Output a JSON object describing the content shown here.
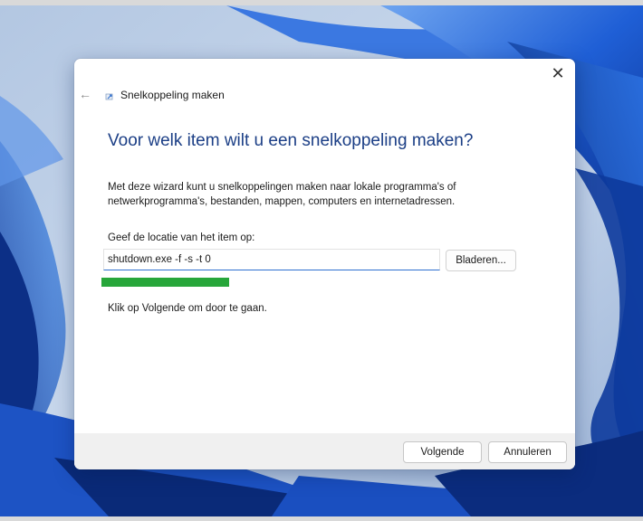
{
  "window": {
    "title": "Snelkoppeling maken",
    "close_glyph": "✕",
    "back_glyph": "←"
  },
  "wizard": {
    "heading": "Voor welk item wilt u een snelkoppeling maken?",
    "description": "Met deze wizard kunt u snelkoppelingen maken naar lokale programma's of netwerkprogramma's, bestanden, mappen, computers en internetadressen.",
    "field_label": "Geef de locatie van het item op:",
    "location_value": "shutdown.exe -f -s -t 0",
    "browse_label": "Bladeren...",
    "instruction": "Klik op Volgende om door te gaan."
  },
  "footer": {
    "next_label": "Volgende",
    "cancel_label": "Annuleren"
  },
  "icons": {
    "close": "close-icon",
    "back": "back-arrow-icon",
    "app": "shortcut-icon"
  },
  "colors": {
    "heading": "#1c3f86",
    "input_underline": "#2e6fd0",
    "highlight": "#27a63a",
    "footer_bg": "#f0f0f0",
    "wallpaper_blue": "#1f5fd6"
  }
}
